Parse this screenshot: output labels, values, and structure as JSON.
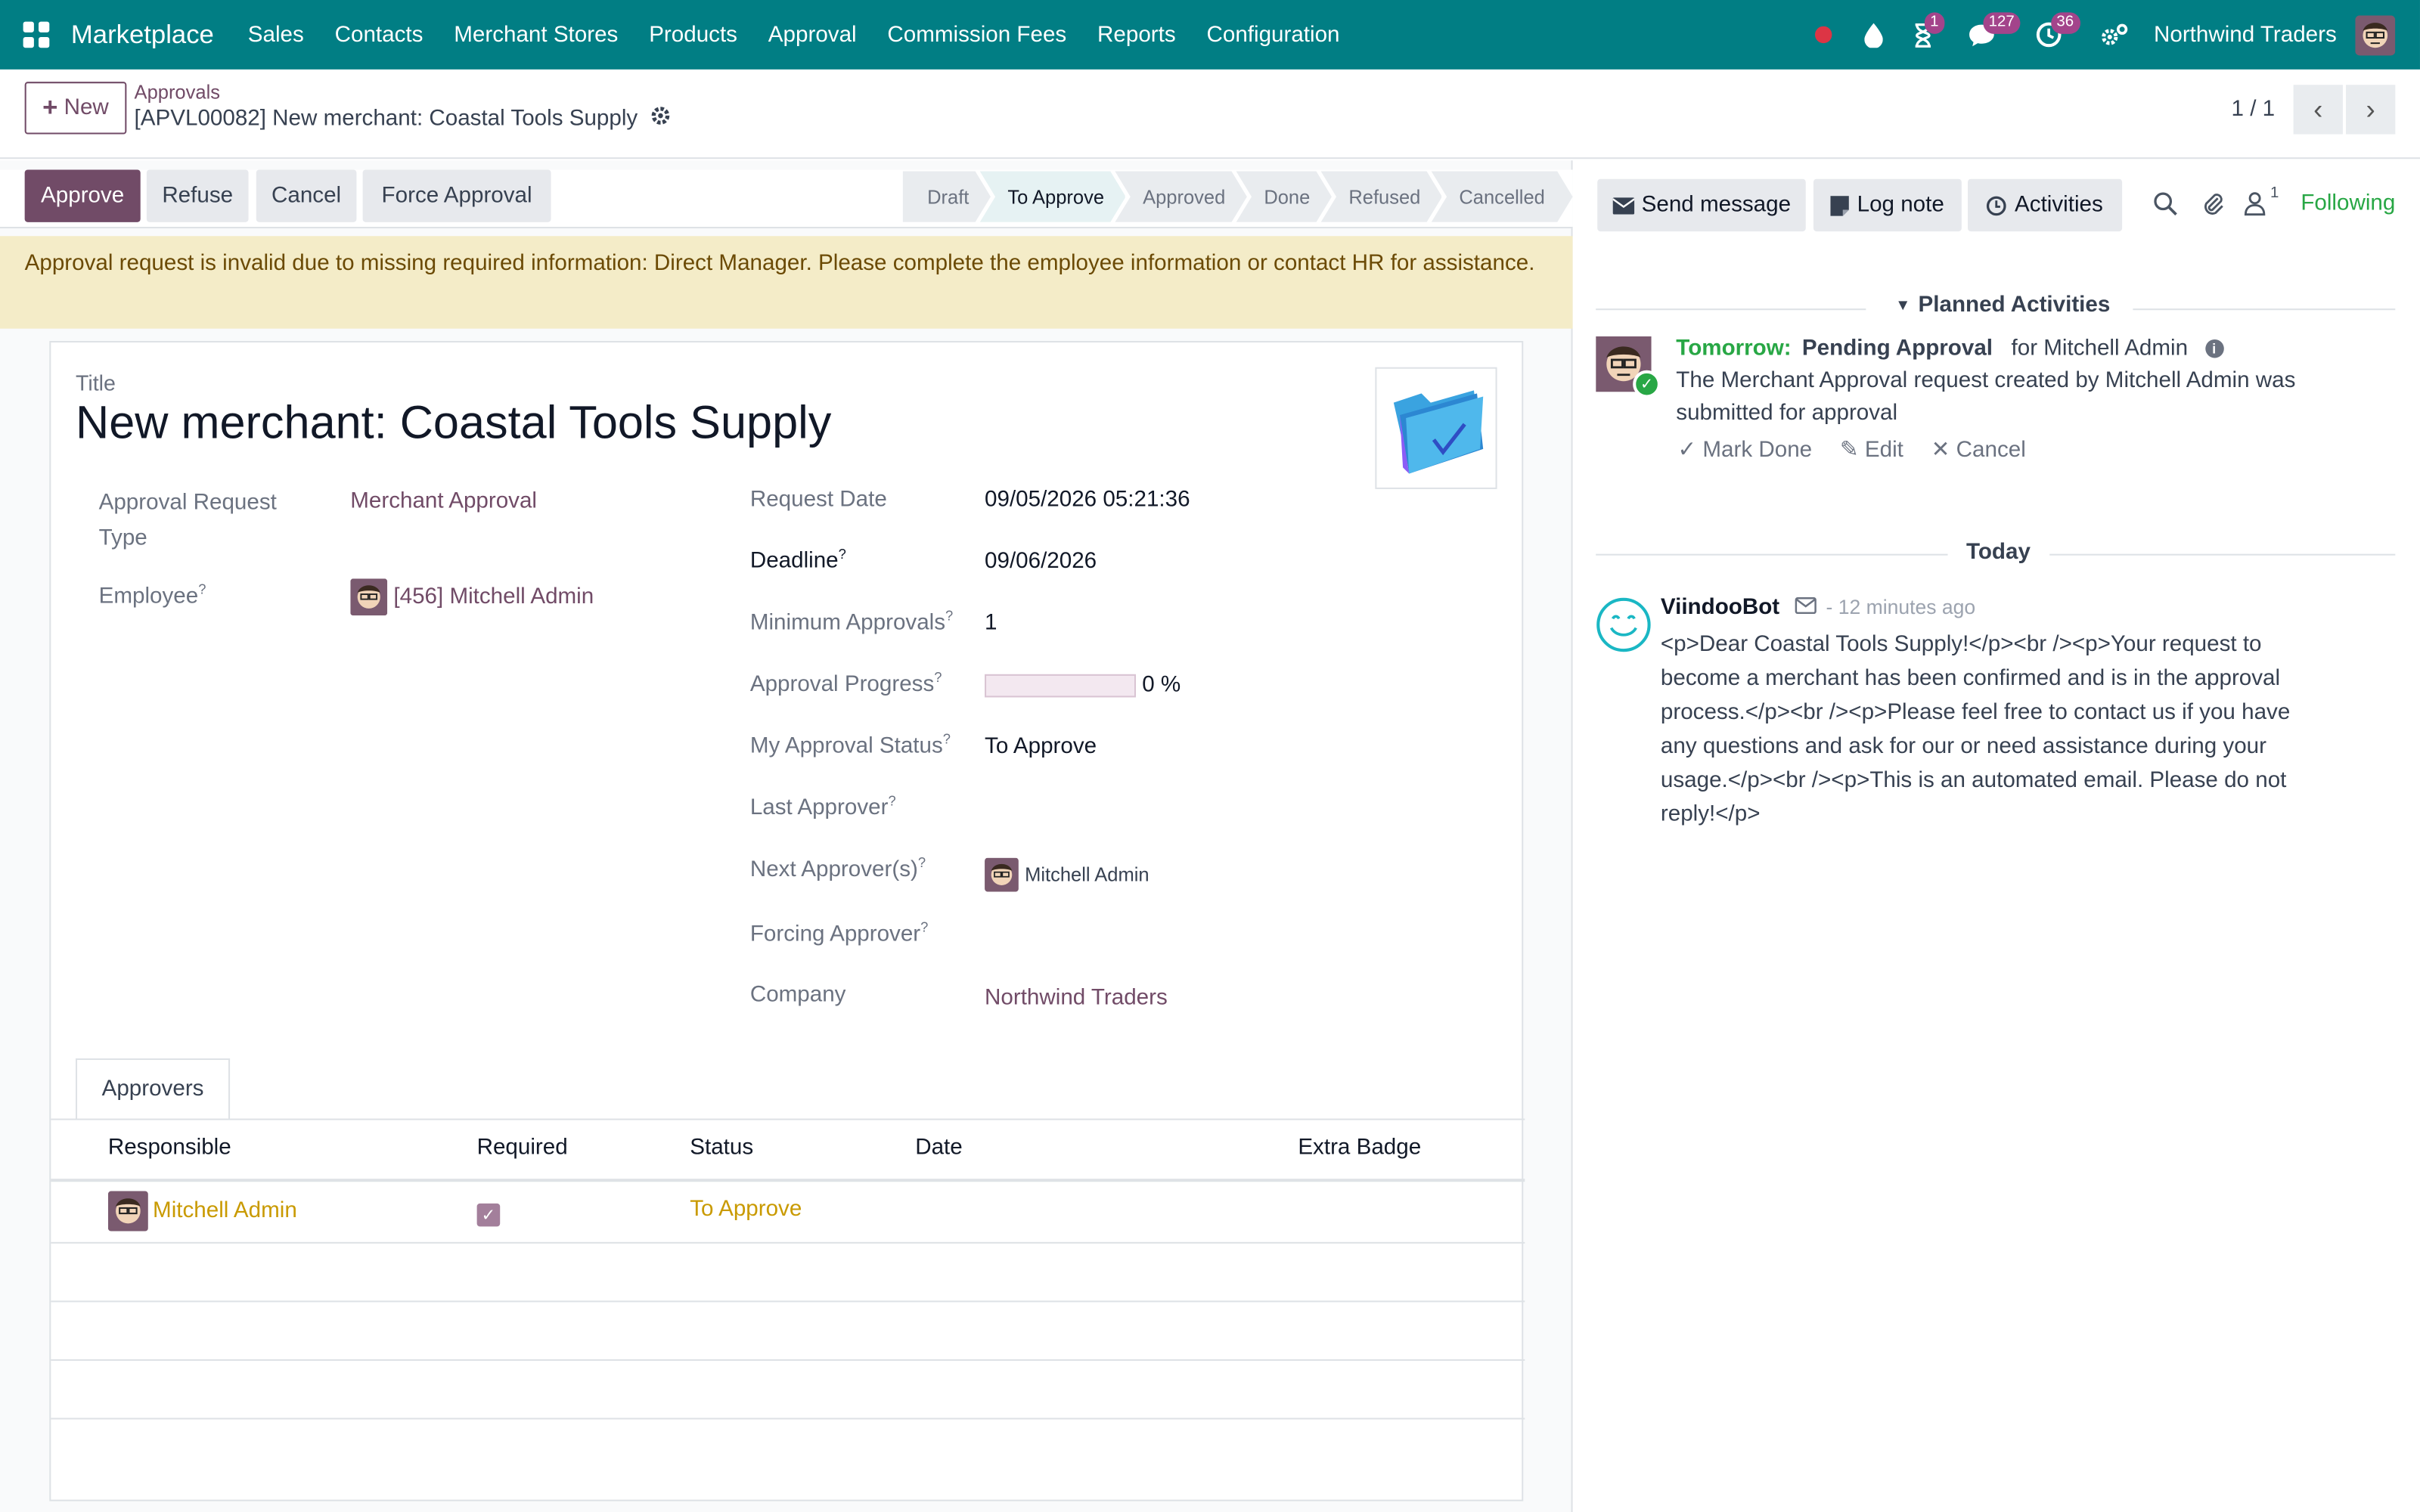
{
  "nav": {
    "brand": "Marketplace",
    "menus": [
      "Sales",
      "Contacts",
      "Merchant Stores",
      "Products",
      "Approval",
      "Commission Fees",
      "Reports",
      "Configuration"
    ],
    "badges": {
      "activity": "1",
      "messages": "127",
      "clock": "36"
    },
    "company": "Northwind Traders"
  },
  "control": {
    "new_label": "New",
    "breadcrumb_parent": "Approvals",
    "breadcrumb_current": "[APVL00082] New merchant: Coastal Tools Supply",
    "pager": "1 / 1"
  },
  "statusbar": {
    "approve": "Approve",
    "refuse": "Refuse",
    "cancel": "Cancel",
    "force": "Force Approval",
    "stages": [
      "Draft",
      "To Approve",
      "Approved",
      "Done",
      "Refused",
      "Cancelled"
    ],
    "active_stage": "To Approve"
  },
  "alert": "Approval request is invalid due to missing required information: Direct Manager. Please complete the employee information or contact HR for assistance.",
  "form": {
    "title_label": "Title",
    "title": "New merchant: Coastal Tools Supply",
    "approval_type_label": "Approval Request Type",
    "approval_type": "Merchant Approval",
    "employee_label": "Employee",
    "employee": "[456] Mitchell Admin",
    "request_date_label": "Request Date",
    "request_date": "09/05/2026 05:21:36",
    "deadline_label": "Deadline",
    "deadline": "09/06/2026",
    "min_approvals_label": "Minimum Approvals",
    "min_approvals": "1",
    "progress_label": "Approval Progress",
    "progress_value": 0,
    "progress_text": "0 %",
    "my_status_label": "My Approval Status",
    "my_status": "To Approve",
    "last_approver_label": "Last Approver",
    "next_approvers_label": "Next Approver(s)",
    "next_approver": "Mitchell Admin",
    "forcing_approver_label": "Forcing Approver",
    "company_label": "Company",
    "company": "Northwind Traders"
  },
  "approvers": {
    "tab": "Approvers",
    "columns": [
      "Responsible",
      "Required",
      "Status",
      "Date",
      "Extra Badge"
    ],
    "rows": [
      {
        "responsible": "Mitchell Admin",
        "required": true,
        "status": "To Approve",
        "date": "",
        "extra": ""
      }
    ]
  },
  "chatter": {
    "send_message": "Send message",
    "log_note": "Log note",
    "activities": "Activities",
    "followers_count": "1",
    "following": "Following",
    "planned_title": "Planned Activities",
    "activity": {
      "when": "Tomorrow:",
      "type": "Pending Approval",
      "for": "for Mitchell Admin",
      "desc": "The Merchant Approval request created by Mitchell Admin was submitted for approval",
      "mark_done": "Mark Done",
      "edit": "Edit",
      "cancel": "Cancel"
    },
    "today": "Today",
    "message": {
      "author": "ViindooBot",
      "time": "- 12 minutes ago",
      "body": "<p>Dear Coastal Tools Supply!</p><br /><p>Your request to become a merchant has been confirmed and is in the approval process.</p><br /><p>Please feel free to contact us if you have any questions and ask for our or need assistance during your usage.</p><br /><p>This is an automated email. Please do not reply!</p>"
    }
  },
  "colors": {
    "navbar": "#017e84",
    "primary": "#714b67",
    "alert_bg": "#f4ecc8",
    "success": "#28a745",
    "status_text": "#c99a00"
  }
}
